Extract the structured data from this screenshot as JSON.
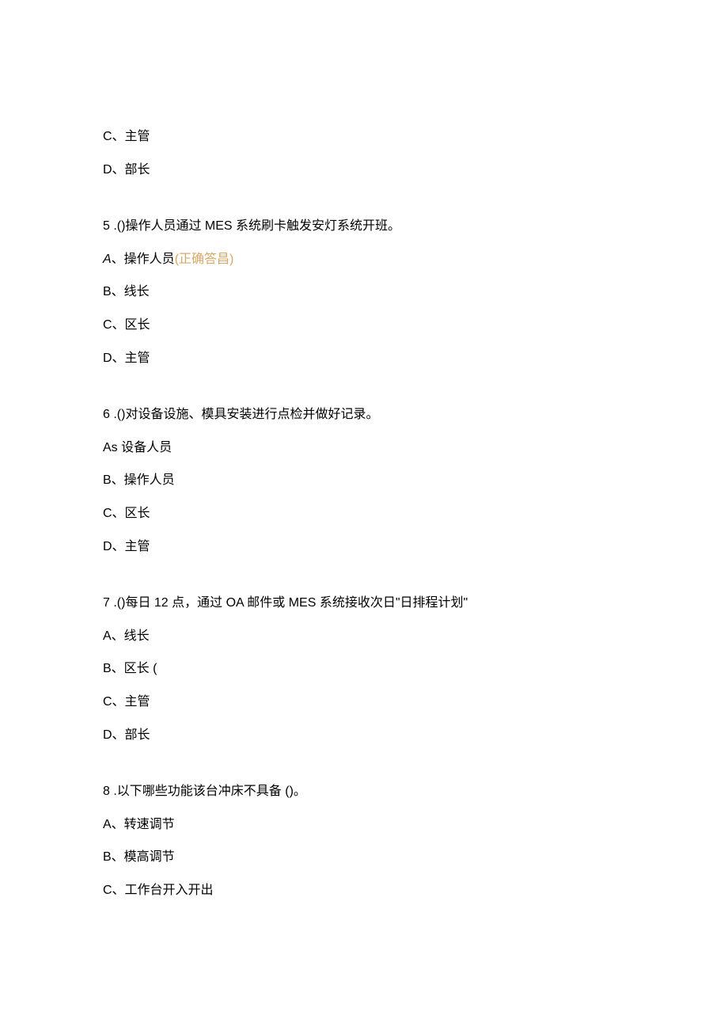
{
  "q4_partial": {
    "optionC": "C、主管",
    "optionD": "D、部长"
  },
  "q5": {
    "number": "5",
    "text": "  .()操作人员通过 MES 系统刷卡触发安灯系统开班。",
    "optionA_prefix": "A",
    "optionA_text": "、操作人员",
    "optionA_answer": "(正确答昌)",
    "optionB": "B、线长",
    "optionC": "C、区长",
    "optionD": "D、主管"
  },
  "q6": {
    "number": "6",
    "text": "  .()对设备设施、模具安装进行点检并做好记录。",
    "optionA": "As 设备人员",
    "optionB": "B、操作人员",
    "optionC": "C、区长",
    "optionD": "D、主管"
  },
  "q7": {
    "number": "7",
    "text": "  .()每日 12 点，通过 OA 邮件或 MES 系统接收次日\"日排程计划\"",
    "optionA": "A、线长",
    "optionB": "B、区长 (",
    "optionC": "C、主管",
    "optionD": "D、部长"
  },
  "q8": {
    "number": "8",
    "text": "  .以下哪些功能该台冲床不具备 ()。",
    "optionA": "A、转速调节",
    "optionB": "B、模高调节",
    "optionC": "C、工作台开入开出"
  }
}
